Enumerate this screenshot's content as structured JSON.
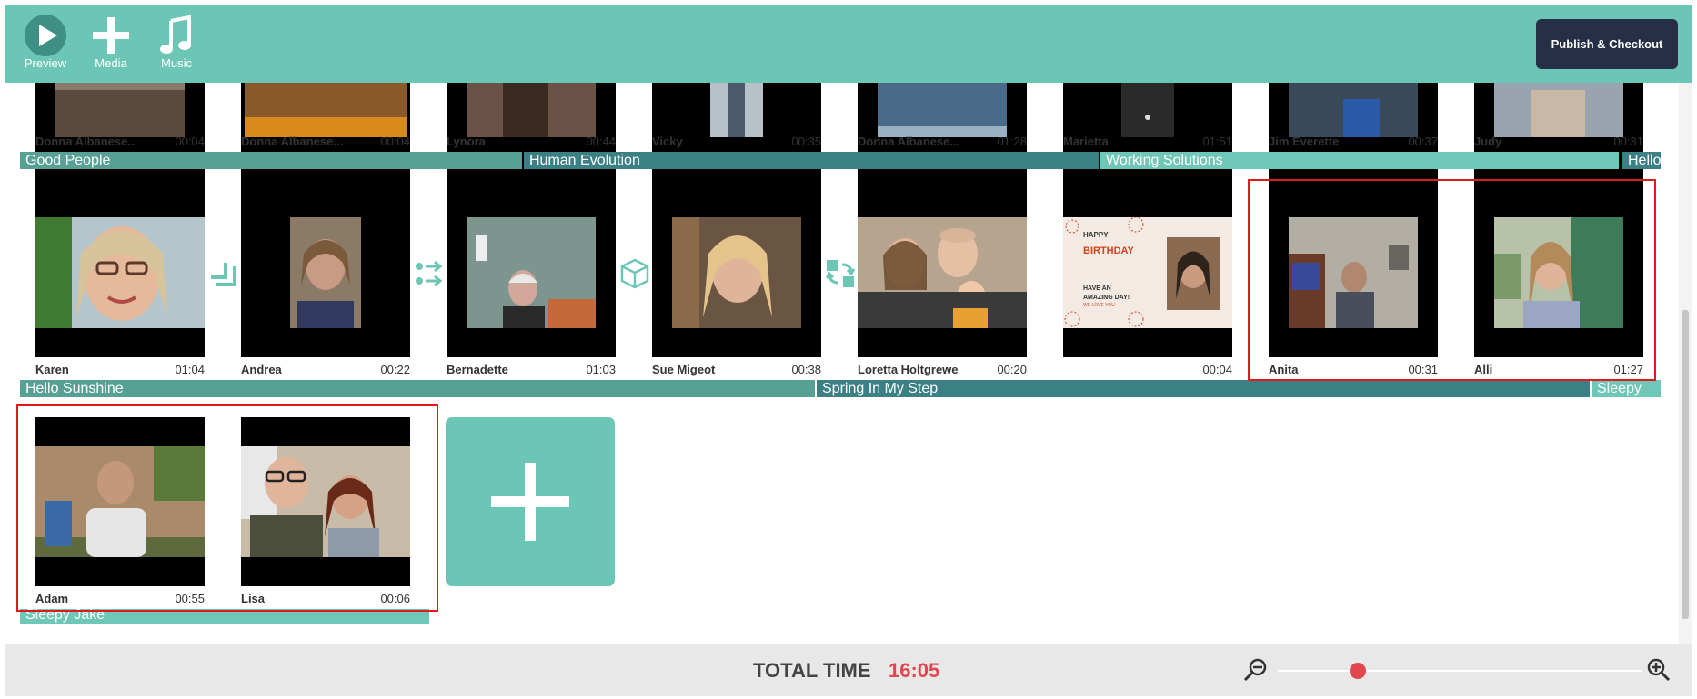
{
  "toolbar": {
    "preview_label": "Preview",
    "media_label": "Media",
    "music_label": "Music",
    "publish_label": "Publish & Checkout"
  },
  "rows": [
    {
      "clips": [
        {
          "name": "Donna Albanese...",
          "duration": "00:04"
        },
        {
          "name": "Donna Albanese...",
          "duration": "00:04"
        },
        {
          "name": "Lynora",
          "duration": "00:44"
        },
        {
          "name": "Vicky",
          "duration": "00:35"
        },
        {
          "name": "Donna Albanese...",
          "duration": "01:28"
        },
        {
          "name": "Marietta",
          "duration": "01:51"
        },
        {
          "name": "Jim Everette",
          "duration": "00:37"
        },
        {
          "name": "Judy",
          "duration": "00:31"
        }
      ],
      "songs": [
        "Good People",
        "Human Evolution",
        "Working Solutions",
        "Hello"
      ]
    },
    {
      "clips": [
        {
          "name": "Karen",
          "duration": "01:04"
        },
        {
          "name": "Andrea",
          "duration": "00:22"
        },
        {
          "name": "Bernadette",
          "duration": "01:03"
        },
        {
          "name": "Sue Migeot",
          "duration": "00:38"
        },
        {
          "name": "Loretta Holtgrewe",
          "duration": "00:20"
        },
        {
          "name": "",
          "duration": "00:04"
        },
        {
          "name": "Anita",
          "duration": "00:31"
        },
        {
          "name": "Alli",
          "duration": "01:27"
        }
      ],
      "songs": [
        "Hello Sunshine",
        "Spring In My Step",
        "Sleepy"
      ]
    },
    {
      "clips": [
        {
          "name": "Adam",
          "duration": "00:55"
        },
        {
          "name": "Lisa",
          "duration": "00:06"
        }
      ],
      "songs": [
        "Sleepy Jake"
      ]
    }
  ],
  "birthday_card": {
    "line1": "HAPPY",
    "line2": "BIRTHDAY",
    "line3": "HAVE AN",
    "line4": "AMAZING DAY!",
    "line5": "WE LOVE YOU"
  },
  "footer": {
    "total_label": "TOTAL TIME",
    "total_value": "16:05",
    "zoom_level": 0.22
  },
  "colors": {
    "accent": "#6cc6b6",
    "publish_bg": "#262f45",
    "total_time": "#e2474d",
    "selection": "#e0191c"
  },
  "icons": {
    "transitions": [
      "corner-wipe-icon",
      "dots-arrows-icon",
      "cube-icon",
      "rotate-swap-icon"
    ]
  }
}
